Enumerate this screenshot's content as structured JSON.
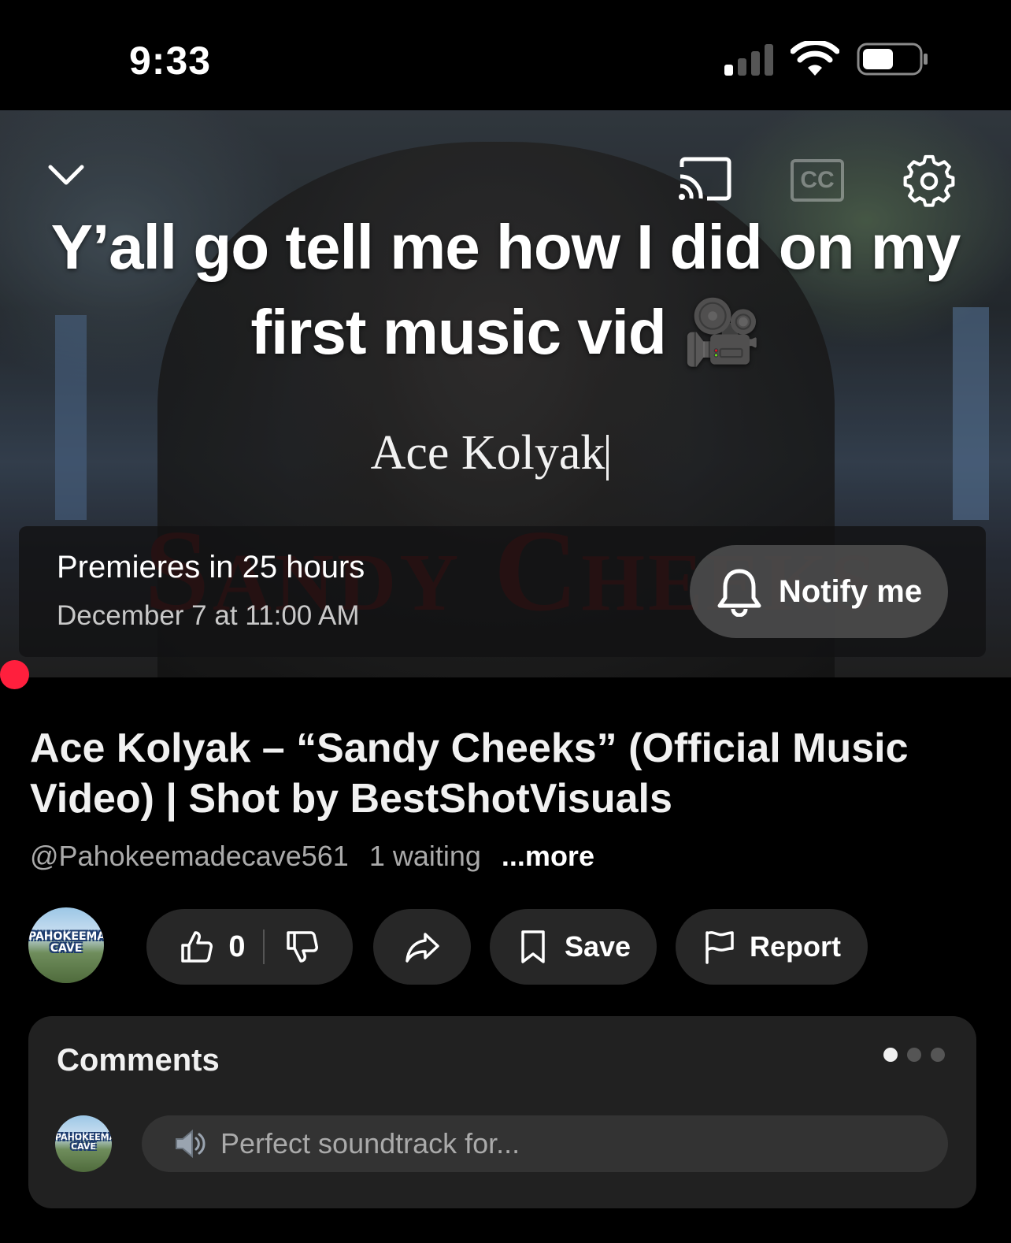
{
  "status_bar": {
    "time": "9:33",
    "icons": [
      "cellular-signal-icon",
      "wifi-icon",
      "battery-icon"
    ]
  },
  "player": {
    "overlay_caption": "Y’all go tell me how I did on my first music vid 🎥",
    "artist_overlay": "Ace Kolyak",
    "song_overlay": "Sandy Cheeks",
    "cc_label": "CC",
    "icons": [
      "chevron-down-icon",
      "cast-icon",
      "captions-icon",
      "gear-icon"
    ],
    "premiere": {
      "title": "Premieres in 25 hours",
      "date": "December 7 at 11:00 AM",
      "notify_label": "Notify me"
    },
    "accent_color": "#ff1f3d"
  },
  "video": {
    "title": "Ace Kolyak – “Sandy Cheeks” (Official Music Video) | Shot by BestShotVisuals",
    "channel_handle": "@Pahokeemadecave561",
    "waiting": "1 waiting",
    "more_label": "...more",
    "channel_avatar_text": "PAHOKEEMADE CAVE"
  },
  "actions": {
    "like_count": "0",
    "save_label": "Save",
    "report_label": "Report",
    "icons": [
      "thumbs-up-icon",
      "thumbs-down-icon",
      "share-icon",
      "bookmark-icon",
      "flag-icon"
    ]
  },
  "comments": {
    "header": "Comments",
    "placeholder": "Perfect soundtrack for...",
    "placeholder_emoji": "speaker-icon",
    "page_count": 3,
    "active_page": 1
  }
}
